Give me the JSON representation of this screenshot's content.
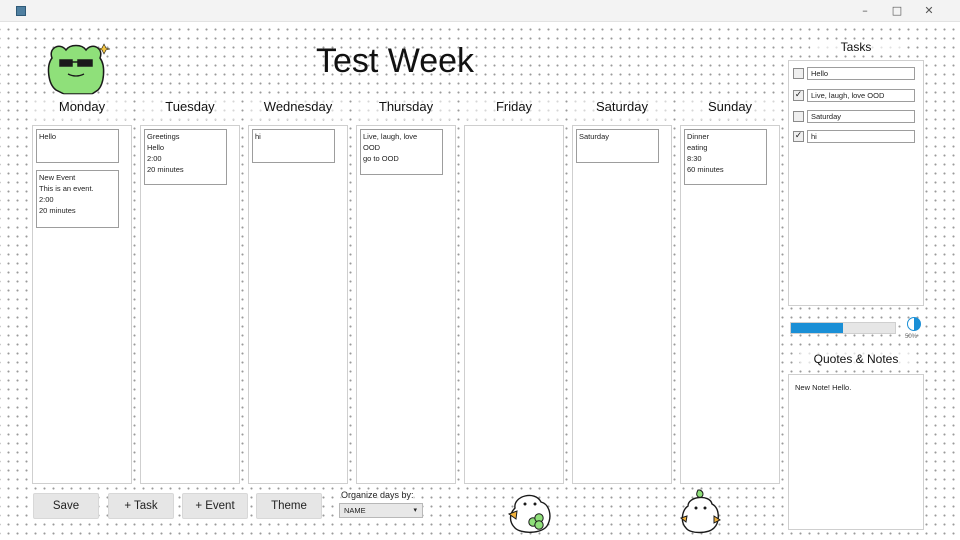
{
  "window": {
    "minimize_glyph": "–",
    "maximize_glyph": "□",
    "close_glyph": "✕"
  },
  "header": {
    "title": "Test Week"
  },
  "days": [
    {
      "label": "Monday",
      "events": [
        {
          "lines": [
            "Hello"
          ]
        },
        {
          "lines": [
            "New Event",
            "This is an event.",
            "2:00",
            "20 minutes"
          ]
        }
      ]
    },
    {
      "label": "Tuesday",
      "events": [
        {
          "lines": [
            "Greetings",
            "Hello",
            "2:00",
            "20 minutes"
          ]
        }
      ]
    },
    {
      "label": "Wednesday",
      "events": [
        {
          "lines": [
            "hi"
          ]
        }
      ]
    },
    {
      "label": "Thursday",
      "events": [
        {
          "lines": [
            "Live, laugh, love",
            "OOD",
            "go to OOD"
          ]
        }
      ]
    },
    {
      "label": "Friday",
      "events": []
    },
    {
      "label": "Saturday",
      "events": [
        {
          "lines": [
            "Saturday"
          ]
        }
      ]
    },
    {
      "label": "Sunday",
      "events": [
        {
          "lines": [
            "Dinner",
            "eating",
            "8:30",
            "60 minutes"
          ]
        }
      ]
    }
  ],
  "tasks": {
    "title": "Tasks",
    "items": [
      {
        "label": "Hello",
        "checked": false
      },
      {
        "label": "Live, laugh, love OOD",
        "checked": true
      },
      {
        "label": "Saturday",
        "checked": false
      },
      {
        "label": "hi",
        "checked": true
      }
    ],
    "check_glyph": "✓"
  },
  "progress": {
    "fraction": 0.5,
    "label": "50%"
  },
  "notes": {
    "title": "Quotes & Notes",
    "text": "New Note! Hello."
  },
  "toolbar": {
    "save_label": "Save",
    "task_label": "+ Task",
    "event_label": "+ Event",
    "theme_label": "Theme",
    "organize_label": "Organize days by:",
    "organize_value": "NAME",
    "chevron_glyph": "▾"
  },
  "colors": {
    "frog": "#8fe07a",
    "progress": "#1a8fd6",
    "duck_beak": "#f2b33d",
    "clover": "#8fe07a"
  }
}
